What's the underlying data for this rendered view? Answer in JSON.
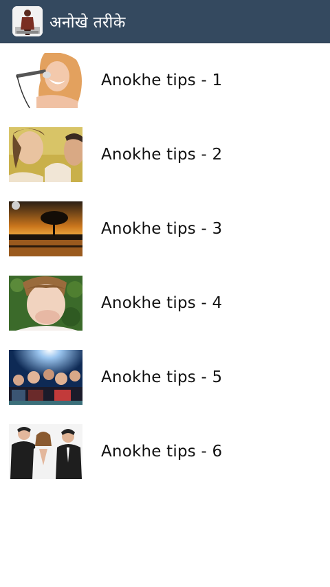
{
  "action_bar": {
    "title": "अनोखे तरीके",
    "background": "#34495f",
    "icon": "app-logo-icon"
  },
  "list": {
    "items": [
      {
        "label": "Anokhe tips - 1",
        "thumbnail": "woman-singing-thumbnail"
      },
      {
        "label": "Anokhe tips - 2",
        "thumbnail": "couple-thumbnail"
      },
      {
        "label": "Anokhe tips - 3",
        "thumbnail": "tree-sunset-thumbnail"
      },
      {
        "label": "Anokhe tips - 4",
        "thumbnail": "surprised-woman-thumbnail"
      },
      {
        "label": "Anokhe tips - 5",
        "thumbnail": "cinema-audience-thumbnail"
      },
      {
        "label": "Anokhe tips - 6",
        "thumbnail": "whisper-trio-thumbnail"
      }
    ]
  }
}
